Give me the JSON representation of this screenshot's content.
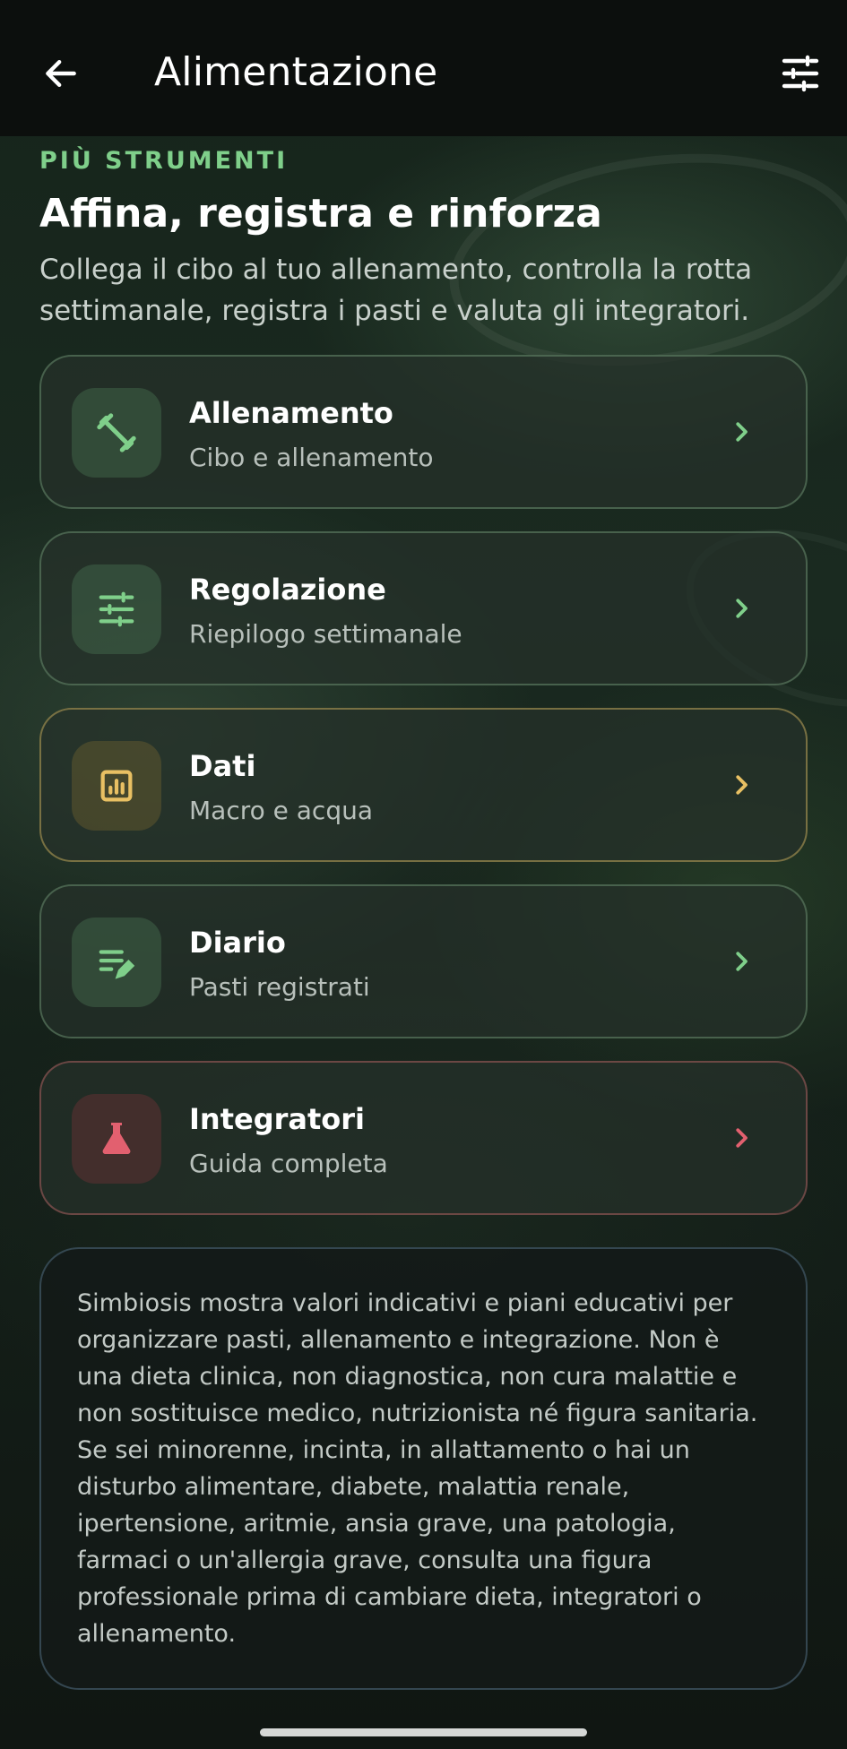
{
  "appbar": {
    "title": "Alimentazione",
    "back_icon": "arrow-left-icon",
    "filter_icon": "tune-icon"
  },
  "section": {
    "eyebrow": "PIÙ STRUMENTI",
    "headline": "Affina, registra e rinforza",
    "subtitle": "Collega il cibo al tuo allenamento, controlla la rotta settimanale, registra i pasti e valuta gli integratori."
  },
  "cards": [
    {
      "title": "Allenamento",
      "subtitle": "Cibo e allenamento",
      "icon": "dumbbell-icon",
      "accent": "#7fcf8a"
    },
    {
      "title": "Regolazione",
      "subtitle": "Riepilogo settimanale",
      "icon": "tune-icon",
      "accent": "#7fcf8a"
    },
    {
      "title": "Dati",
      "subtitle": "Macro e acqua",
      "icon": "chart-icon",
      "accent": "#e8c063"
    },
    {
      "title": "Diario",
      "subtitle": "Pasti registrati",
      "icon": "edit-note-icon",
      "accent": "#7fcf8a"
    },
    {
      "title": "Integratori",
      "subtitle": "Guida completa",
      "icon": "flask-icon",
      "accent": "#e2606f"
    }
  ],
  "disclaimer": "Simbiosis mostra valori indicativi e piani educativi per organizzare pasti, allenamento e integrazione. Non è una dieta clinica, non diagnostica, non cura malattie e non sostituisce medico, nutrizionista né figura sanitaria. Se sei minorenne, incinta, in allattamento o hai un disturbo alimentare, diabete, malattia renale, ipertensione, aritmie, ansia grave, una patologia, farmaci o un'allergia grave, consulta una figura professionale prima di cambiare dieta, integratori o allenamento."
}
